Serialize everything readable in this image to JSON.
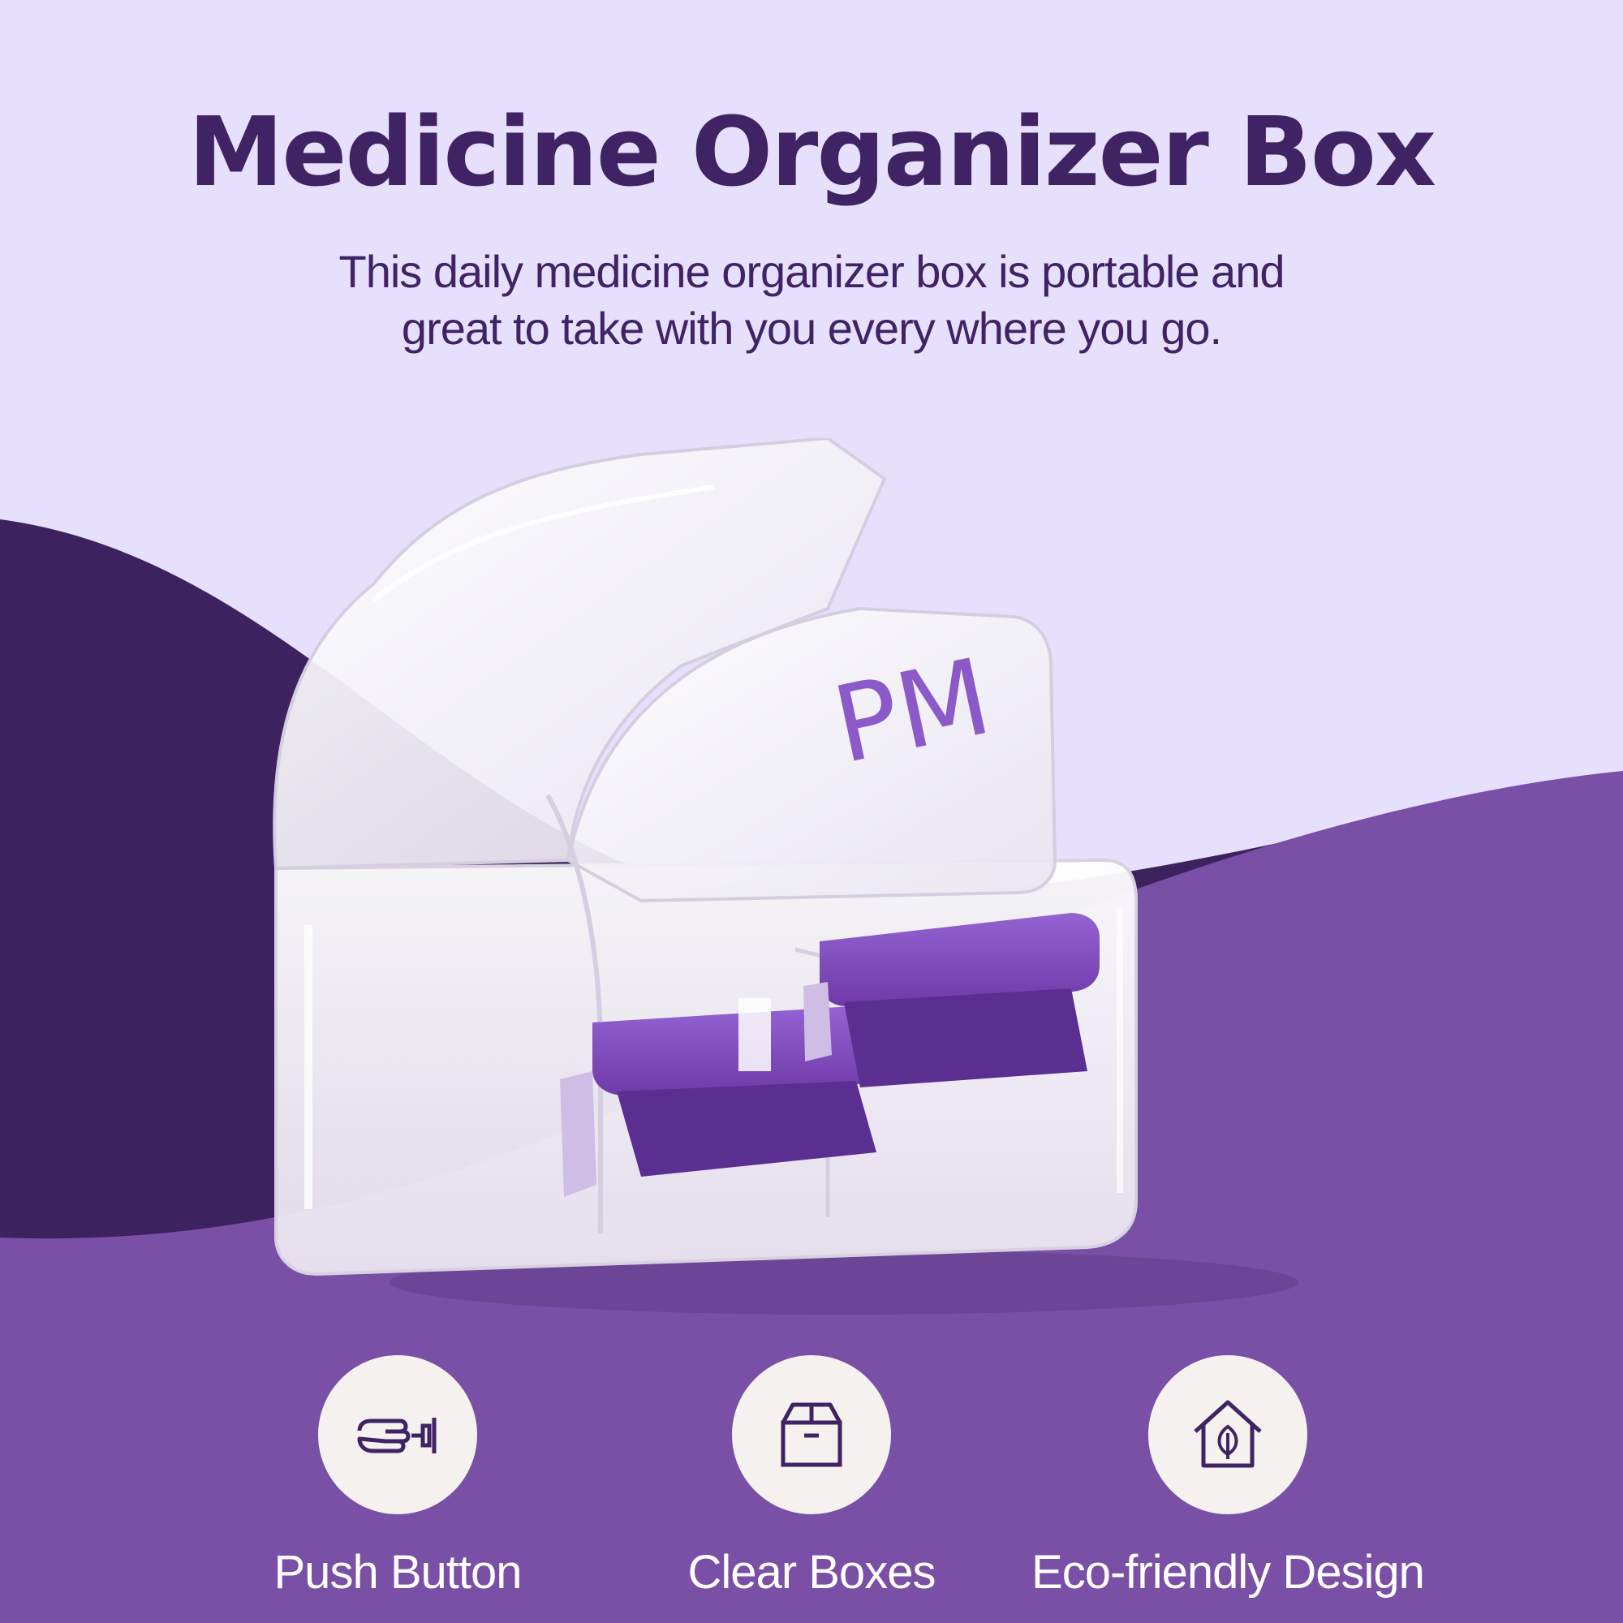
{
  "title": "Medicine Organizer Box",
  "subtitle": "This daily medicine organizer box  is portable and great to take with you every where you go.",
  "product": {
    "lid_label": "PM"
  },
  "features": [
    {
      "icon": "pointing-hand-button-icon",
      "label": "Push Button"
    },
    {
      "icon": "box-icon",
      "label": "Clear Boxes"
    },
    {
      "icon": "eco-house-leaf-icon",
      "label": "Eco-friendly Design"
    }
  ],
  "colors": {
    "background_light": "#e6e0fc",
    "wave_dark": "#3c225e",
    "wave_purple": "#7a4fa6",
    "title_text": "#3f2364",
    "accent_purple": "#8c5ac8",
    "icon_circle": "#f4f1ee",
    "icon_stroke": "#3f2364"
  }
}
